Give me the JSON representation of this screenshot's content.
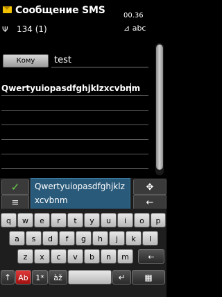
{
  "status": {
    "title": "Сообщение SMS",
    "time": "00.36",
    "signal": "Ψ",
    "counter": "134 (1)",
    "input_mode": "⊿ abc",
    "message_icon": "envelope-icon"
  },
  "compose": {
    "to_label": "Кому",
    "to_value": "test",
    "message_text": "Qwertyuiopasdfghjklzxcvbnm"
  },
  "predictive": {
    "text": "Qwertyuiopasdfghjklzxcvbnm",
    "ok_icon": "✓",
    "menu_icon": "≡",
    "move_icon": "✥",
    "back_icon": "←"
  },
  "keyboard": {
    "row1": [
      "q",
      "w",
      "e",
      "r",
      "t",
      "y",
      "u",
      "i",
      "o",
      "p"
    ],
    "row2": [
      "a",
      "s",
      "d",
      "f",
      "g",
      "h",
      "j",
      "k",
      "l"
    ],
    "row3": [
      "z",
      "x",
      "c",
      "v",
      "b",
      "n",
      "m"
    ],
    "row3_back": "←",
    "shift": "↑",
    "case_key": "Ab",
    "num_key": "1*",
    "accent_key": "àž",
    "space_key": " ",
    "enter_key": "↵",
    "layout_key": "▦"
  },
  "colors": {
    "ok_green": "#6cd04a",
    "predict_bg": "#2a5a7a",
    "case_key_red": "#c02020"
  }
}
